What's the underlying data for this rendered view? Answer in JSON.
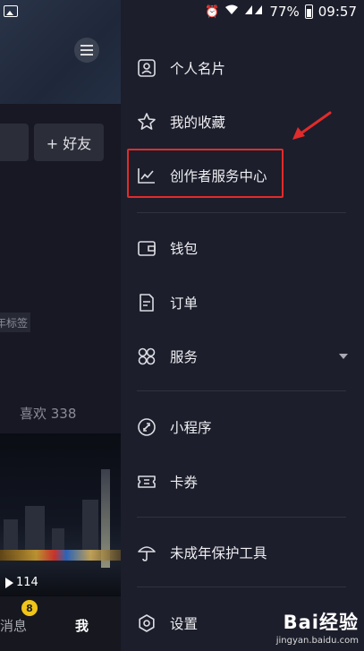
{
  "status_bar": {
    "battery": "77%",
    "time": "09:57"
  },
  "profile_bg": {
    "add_friend": "+ 好友",
    "tag_fragment": "年标签",
    "likes": "喜欢 338",
    "play_count": "114",
    "nav": {
      "messages": "消息",
      "messages_badge": "8",
      "me": "我"
    }
  },
  "drawer": {
    "items": [
      {
        "label": "个人名片",
        "icon": "id-card-icon"
      },
      {
        "label": "我的收藏",
        "icon": "star-icon"
      },
      {
        "label": "创作者服务中心",
        "icon": "chart-line-icon"
      },
      {
        "label": "钱包",
        "icon": "wallet-icon"
      },
      {
        "label": "订单",
        "icon": "document-icon"
      },
      {
        "label": "服务",
        "icon": "grid-flower-icon"
      },
      {
        "label": "小程序",
        "icon": "link-icon"
      },
      {
        "label": "卡券",
        "icon": "ticket-icon"
      },
      {
        "label": "未成年保护工具",
        "icon": "umbrella-icon"
      },
      {
        "label": "设置",
        "icon": "gear-icon"
      }
    ]
  },
  "annotation": {
    "highlight_color": "#e22b2b"
  },
  "watermark": {
    "brand": "Bai经验",
    "url": "jingyan.baidu.com"
  }
}
